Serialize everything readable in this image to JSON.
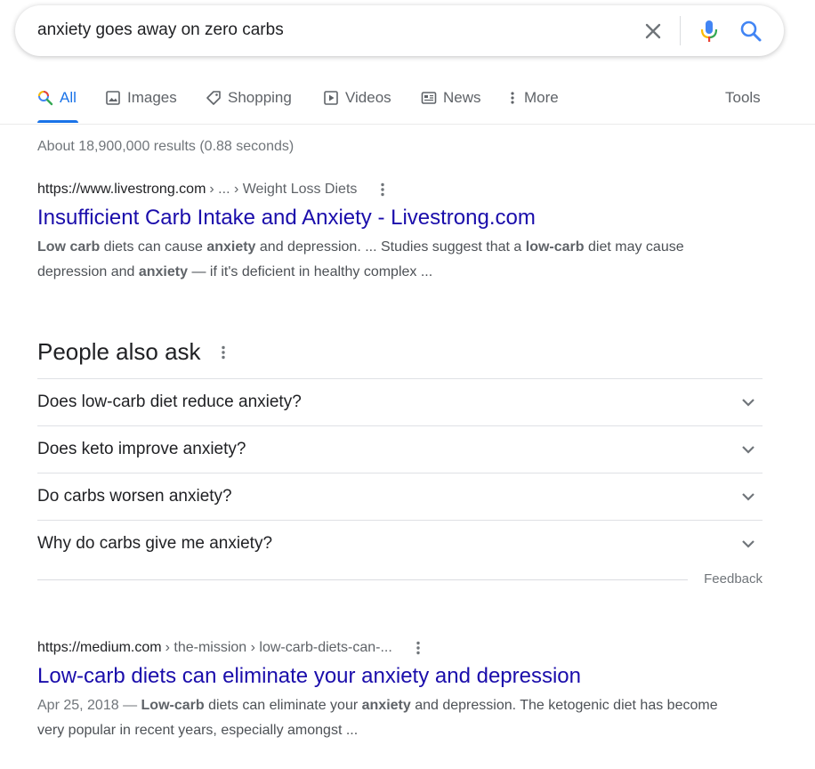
{
  "search": {
    "query": "anxiety goes away on zero carbs"
  },
  "tabs": [
    {
      "label": "All",
      "icon": "search-icon",
      "active": true
    },
    {
      "label": "Images",
      "icon": "image-icon"
    },
    {
      "label": "Shopping",
      "icon": "tag-icon"
    },
    {
      "label": "Videos",
      "icon": "play-icon"
    },
    {
      "label": "News",
      "icon": "newspaper-icon"
    },
    {
      "label": "More",
      "icon": "kebab-icon"
    },
    {
      "label": "Tools"
    }
  ],
  "stats": "About 18,900,000 results (0.88 seconds)",
  "results": [
    {
      "domain": "https://www.livestrong.com",
      "path": "› ... › Weight Loss Diets",
      "title": "Insufficient Carb Intake and Anxiety - Livestrong.com",
      "snippet": {
        "p1": "Low carb",
        "p2": " diets can cause ",
        "p3": "anxiety",
        "p4": " and depression. ... Studies suggest that a ",
        "p5": "low-carb",
        "p6": " diet may cause depression and ",
        "p7": "anxiety",
        "p8": " — if it's deficient in healthy complex ..."
      }
    },
    {
      "domain": "https://medium.com",
      "path": "› the-mission › low-carb-diets-can-...",
      "title": "Low-carb diets can eliminate your anxiety and depression",
      "snippet": {
        "date": "Apr 25, 2018 — ",
        "p1": "Low-carb",
        "p2": " diets can eliminate your ",
        "p3": "anxiety",
        "p4": " and depression. The ketogenic diet has become very popular in recent years, especially amongst ..."
      }
    }
  ],
  "people_also_ask": {
    "title": "People also ask",
    "questions": [
      "Does low-carb diet reduce anxiety?",
      "Does keto improve anxiety?",
      "Do carbs worsen anxiety?",
      "Why do carbs give me anxiety?"
    ],
    "feedback": "Feedback"
  },
  "colors": {
    "link": "#1a0dab",
    "accent": "#1a73e8",
    "mic_blue": "#4285f4",
    "mic_red": "#ea4335",
    "mic_yellow": "#fbbc04",
    "mic_green": "#34a853"
  }
}
